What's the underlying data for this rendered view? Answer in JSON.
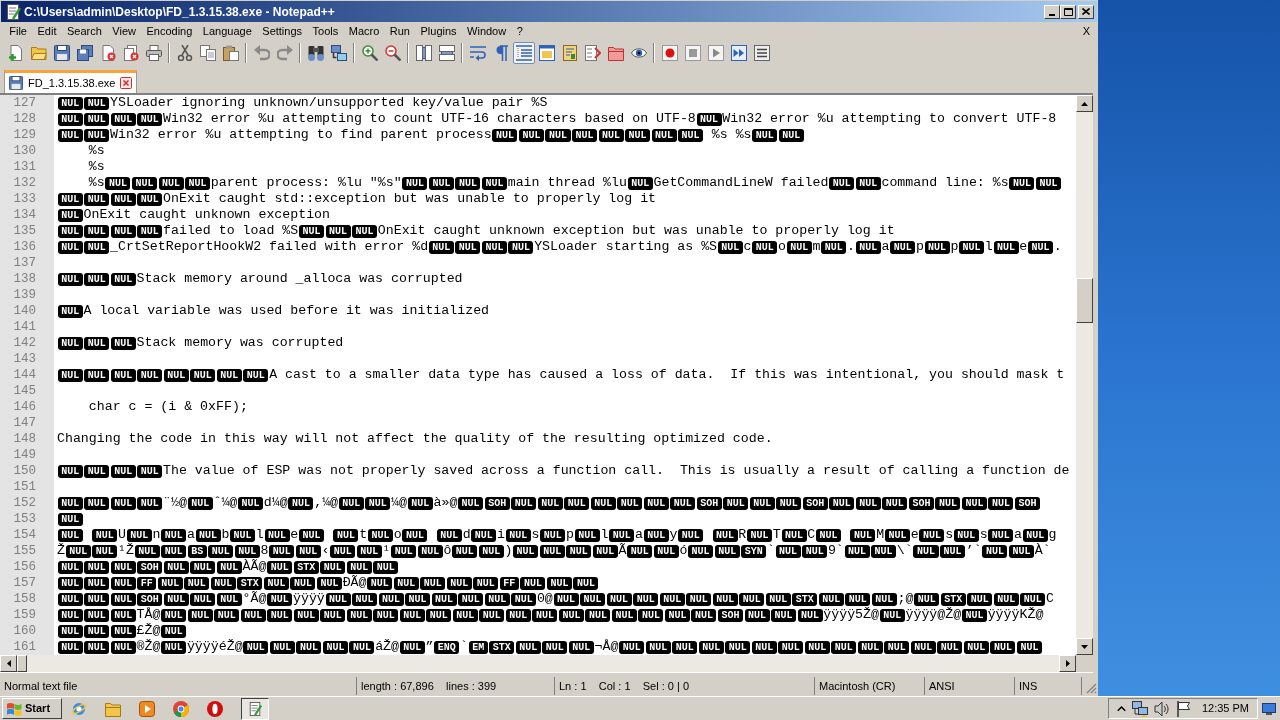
{
  "window": {
    "title": "C:\\Users\\admin\\Desktop\\FD_1.3.15.38.exe - Notepad++"
  },
  "menu": {
    "items": [
      "File",
      "Edit",
      "Search",
      "View",
      "Encoding",
      "Language",
      "Settings",
      "Tools",
      "Macro",
      "Run",
      "Plugins",
      "Window",
      "?"
    ],
    "close_label": "X"
  },
  "toolbar": [
    {
      "buttons": [
        {
          "kind": "new",
          "pressed": false
        },
        {
          "kind": "open",
          "pressed": false
        },
        {
          "kind": "save",
          "pressed": false
        },
        {
          "kind": "saveall",
          "pressed": false
        },
        {
          "kind": "close",
          "pressed": false
        },
        {
          "kind": "closeall",
          "pressed": false
        },
        {
          "kind": "print",
          "pressed": false
        }
      ]
    },
    {
      "buttons": [
        {
          "kind": "cut",
          "pressed": false
        },
        {
          "kind": "copy",
          "pressed": false
        },
        {
          "kind": "paste",
          "pressed": false
        }
      ]
    },
    {
      "buttons": [
        {
          "kind": "undo",
          "pressed": false
        },
        {
          "kind": "redo",
          "pressed": false
        }
      ]
    },
    {
      "buttons": [
        {
          "kind": "find",
          "pressed": false
        },
        {
          "kind": "replace",
          "pressed": false
        }
      ]
    },
    {
      "buttons": [
        {
          "kind": "zoomin",
          "pressed": false
        },
        {
          "kind": "zoomout",
          "pressed": false
        }
      ]
    },
    {
      "buttons": [
        {
          "kind": "syncv",
          "pressed": false
        },
        {
          "kind": "synch",
          "pressed": false
        }
      ]
    },
    {
      "buttons": [
        {
          "kind": "wrap",
          "pressed": false
        },
        {
          "kind": "allchars",
          "pressed": false
        },
        {
          "kind": "indent",
          "pressed": true
        },
        {
          "kind": "udl",
          "pressed": false
        },
        {
          "kind": "docmap",
          "pressed": false
        },
        {
          "kind": "funclist",
          "pressed": false
        },
        {
          "kind": "workspace",
          "pressed": false
        },
        {
          "kind": "monitor",
          "pressed": false
        }
      ]
    },
    {
      "buttons": [
        {
          "kind": "record",
          "pressed": false
        },
        {
          "kind": "stop",
          "pressed": false
        },
        {
          "kind": "play",
          "pressed": false
        },
        {
          "kind": "playmulti",
          "pressed": false
        },
        {
          "kind": "savemacro",
          "pressed": false
        }
      ]
    }
  ],
  "tabs": [
    {
      "label": "FD_1.3.15.38.exe",
      "selected": true,
      "modified": false
    }
  ],
  "editor": {
    "lines": [
      {
        "number": "127",
        "segments": [
          {
            "kind": "ctrl",
            "text": "NUL"
          },
          {
            "kind": "ctrl",
            "text": "NUL"
          },
          {
            "kind": "text",
            "text": "YSLoader ignoring unknown/unsupported key/value pair %S"
          }
        ]
      },
      {
        "number": "128",
        "segments": [
          {
            "kind": "ctrl",
            "text": "NUL"
          },
          {
            "kind": "ctrl",
            "text": "NUL"
          },
          {
            "kind": "ctrl",
            "text": "NUL"
          },
          {
            "kind": "ctrl",
            "text": "NUL"
          },
          {
            "kind": "text",
            "text": "Win32 error %u attempting to count UTF-16 characters based on UTF-8"
          },
          {
            "kind": "ctrl",
            "text": "NUL"
          },
          {
            "kind": "text",
            "text": "Win32 error %u attempting to convert UTF-8"
          }
        ]
      },
      {
        "number": "129",
        "segments": [
          {
            "kind": "ctrl",
            "text": "NUL"
          },
          {
            "kind": "ctrl",
            "text": "NUL"
          },
          {
            "kind": "text",
            "text": "Win32 error %u attempting to find parent process"
          },
          {
            "kind": "ctrl",
            "text": "NUL"
          },
          {
            "kind": "ctrl",
            "text": "NUL"
          },
          {
            "kind": "ctrl",
            "text": "NUL"
          },
          {
            "kind": "ctrl",
            "text": "NUL"
          },
          {
            "kind": "ctrl",
            "text": "NUL"
          },
          {
            "kind": "ctrl",
            "text": "NUL"
          },
          {
            "kind": "ctrl",
            "text": "NUL"
          },
          {
            "kind": "ctrl",
            "text": "NUL"
          },
          {
            "kind": "text",
            "text": " %s %s"
          },
          {
            "kind": "ctrl",
            "text": "NUL"
          },
          {
            "kind": "ctrl",
            "text": "NUL"
          }
        ]
      },
      {
        "number": "130",
        "segments": [
          {
            "kind": "text",
            "text": "    %s"
          }
        ]
      },
      {
        "number": "131",
        "segments": [
          {
            "kind": "text",
            "text": "    %s"
          }
        ]
      },
      {
        "number": "132",
        "segments": [
          {
            "kind": "text",
            "text": "    %s"
          },
          {
            "kind": "ctrl",
            "text": "NUL"
          },
          {
            "kind": "ctrl",
            "text": "NUL"
          },
          {
            "kind": "ctrl",
            "text": "NUL"
          },
          {
            "kind": "ctrl",
            "text": "NUL"
          },
          {
            "kind": "text",
            "text": "parent process: %lu \"%s\""
          },
          {
            "kind": "ctrl",
            "text": "NUL"
          },
          {
            "kind": "ctrl",
            "text": "NUL"
          },
          {
            "kind": "ctrl",
            "text": "NUL"
          },
          {
            "kind": "ctrl",
            "text": "NUL"
          },
          {
            "kind": "text",
            "text": "main thread %lu"
          },
          {
            "kind": "ctrl",
            "text": "NUL"
          },
          {
            "kind": "text",
            "text": "GetCommandLineW failed"
          },
          {
            "kind": "ctrl",
            "text": "NUL"
          },
          {
            "kind": "ctrl",
            "text": "NUL"
          },
          {
            "kind": "text",
            "text": "command line: %s"
          },
          {
            "kind": "ctrl",
            "text": "NUL"
          },
          {
            "kind": "ctrl",
            "text": "NUL"
          }
        ]
      },
      {
        "number": "133",
        "segments": [
          {
            "kind": "ctrl",
            "text": "NUL"
          },
          {
            "kind": "ctrl",
            "text": "NUL"
          },
          {
            "kind": "ctrl",
            "text": "NUL"
          },
          {
            "kind": "ctrl",
            "text": "NUL"
          },
          {
            "kind": "text",
            "text": "OnExit caught std::exception but was unable to properly log it"
          }
        ]
      },
      {
        "number": "134",
        "segments": [
          {
            "kind": "ctrl",
            "text": "NUL"
          },
          {
            "kind": "text",
            "text": "OnExit caught unknown exception"
          }
        ]
      },
      {
        "number": "135",
        "segments": [
          {
            "kind": "ctrl",
            "text": "NUL"
          },
          {
            "kind": "ctrl",
            "text": "NUL"
          },
          {
            "kind": "ctrl",
            "text": "NUL"
          },
          {
            "kind": "ctrl",
            "text": "NUL"
          },
          {
            "kind": "text",
            "text": "failed to load %S"
          },
          {
            "kind": "ctrl",
            "text": "NUL"
          },
          {
            "kind": "ctrl",
            "text": "NUL"
          },
          {
            "kind": "ctrl",
            "text": "NUL"
          },
          {
            "kind": "text",
            "text": "OnExit caught unknown exception but was unable to properly log it"
          }
        ]
      },
      {
        "number": "136",
        "segments": [
          {
            "kind": "ctrl",
            "text": "NUL"
          },
          {
            "kind": "ctrl",
            "text": "NUL"
          },
          {
            "kind": "text",
            "text": "_CrtSetReportHookW2 failed with error %d"
          },
          {
            "kind": "ctrl",
            "text": "NUL"
          },
          {
            "kind": "ctrl",
            "text": "NUL"
          },
          {
            "kind": "ctrl",
            "text": "NUL"
          },
          {
            "kind": "ctrl",
            "text": "NUL"
          },
          {
            "kind": "text",
            "text": "YSLoader starting as %S"
          },
          {
            "kind": "ctrl",
            "text": "NUL"
          },
          {
            "kind": "text",
            "text": "c"
          },
          {
            "kind": "ctrl",
            "text": "NUL"
          },
          {
            "kind": "text",
            "text": "o"
          },
          {
            "kind": "ctrl",
            "text": "NUL"
          },
          {
            "kind": "text",
            "text": "m"
          },
          {
            "kind": "ctrl",
            "text": "NUL"
          },
          {
            "kind": "text",
            "text": "."
          },
          {
            "kind": "ctrl",
            "text": "NUL"
          },
          {
            "kind": "text",
            "text": "a"
          },
          {
            "kind": "ctrl",
            "text": "NUL"
          },
          {
            "kind": "text",
            "text": "p"
          },
          {
            "kind": "ctrl",
            "text": "NUL"
          },
          {
            "kind": "text",
            "text": "p"
          },
          {
            "kind": "ctrl",
            "text": "NUL"
          },
          {
            "kind": "text",
            "text": "l"
          },
          {
            "kind": "ctrl",
            "text": "NUL"
          },
          {
            "kind": "text",
            "text": "e"
          },
          {
            "kind": "ctrl",
            "text": "NUL"
          },
          {
            "kind": "text",
            "text": "."
          }
        ]
      },
      {
        "number": "137"
      },
      {
        "number": "138",
        "segments": [
          {
            "kind": "ctrl",
            "text": "NUL"
          },
          {
            "kind": "ctrl",
            "text": "NUL"
          },
          {
            "kind": "ctrl",
            "text": "NUL"
          },
          {
            "kind": "text",
            "text": "Stack memory around _alloca was corrupted"
          }
        ]
      },
      {
        "number": "139"
      },
      {
        "number": "140",
        "segments": [
          {
            "kind": "ctrl",
            "text": "NUL"
          },
          {
            "kind": "text",
            "text": "A local variable was used before it was initialized"
          }
        ]
      },
      {
        "number": "141"
      },
      {
        "number": "142",
        "segments": [
          {
            "kind": "ctrl",
            "text": "NUL"
          },
          {
            "kind": "ctrl",
            "text": "NUL"
          },
          {
            "kind": "ctrl",
            "text": "NUL"
          },
          {
            "kind": "text",
            "text": "Stack memory was corrupted"
          }
        ]
      },
      {
        "number": "143"
      },
      {
        "number": "144",
        "segments": [
          {
            "kind": "ctrl",
            "text": "NUL"
          },
          {
            "kind": "ctrl",
            "text": "NUL"
          },
          {
            "kind": "ctrl",
            "text": "NUL"
          },
          {
            "kind": "ctrl",
            "text": "NUL"
          },
          {
            "kind": "ctrl",
            "text": "NUL"
          },
          {
            "kind": "ctrl",
            "text": "NUL"
          },
          {
            "kind": "ctrl",
            "text": "NUL"
          },
          {
            "kind": "ctrl",
            "text": "NUL"
          },
          {
            "kind": "text",
            "text": "A cast to a smaller data type has caused a loss of data.  If this was intentional, you should mask t"
          }
        ]
      },
      {
        "number": "145"
      },
      {
        "number": "146",
        "segments": [
          {
            "kind": "text",
            "text": "    char c = (i & 0xFF);"
          }
        ]
      },
      {
        "number": "147"
      },
      {
        "number": "148",
        "segments": [
          {
            "kind": "text",
            "text": "Changing the code in this way will not affect the quality of the resulting optimized code."
          }
        ]
      },
      {
        "number": "149"
      },
      {
        "number": "150",
        "segments": [
          {
            "kind": "ctrl",
            "text": "NUL"
          },
          {
            "kind": "ctrl",
            "text": "NUL"
          },
          {
            "kind": "ctrl",
            "text": "NUL"
          },
          {
            "kind": "ctrl",
            "text": "NUL"
          },
          {
            "kind": "text",
            "text": "The value of ESP was not properly saved across a function call.  This is usually a result of calling a function de"
          }
        ]
      },
      {
        "number": "151"
      },
      {
        "number": "152",
        "segments": [
          {
            "kind": "ctrl",
            "text": "NUL"
          },
          {
            "kind": "ctrl",
            "text": "NUL"
          },
          {
            "kind": "ctrl",
            "text": "NUL"
          },
          {
            "kind": "ctrl",
            "text": "NUL"
          },
          {
            "kind": "text",
            "text": "¨½@"
          },
          {
            "kind": "ctrl",
            "text": "NUL"
          },
          {
            "kind": "text",
            "text": "ˆ¼@"
          },
          {
            "kind": "ctrl",
            "text": "NUL"
          },
          {
            "kind": "text",
            "text": "d¼@"
          },
          {
            "kind": "ctrl",
            "text": "NUL"
          },
          {
            "kind": "text",
            "text": ",¼@"
          },
          {
            "kind": "ctrl",
            "text": "NUL"
          },
          {
            "kind": "ctrl",
            "text": "NUL"
          },
          {
            "kind": "text",
            "text": "¼@"
          },
          {
            "kind": "ctrl",
            "text": "NUL"
          },
          {
            "kind": "text",
            "text": "à»@"
          },
          {
            "kind": "ctrl",
            "text": "NUL"
          },
          {
            "kind": "ctrl",
            "text": "SOH"
          },
          {
            "kind": "ctrl",
            "text": "NUL"
          },
          {
            "kind": "ctrl",
            "text": "NUL"
          },
          {
            "kind": "ctrl",
            "text": "NUL"
          },
          {
            "kind": "ctrl",
            "text": "NUL"
          },
          {
            "kind": "ctrl",
            "text": "NUL"
          },
          {
            "kind": "ctrl",
            "text": "NUL"
          },
          {
            "kind": "ctrl",
            "text": "NUL"
          },
          {
            "kind": "ctrl",
            "text": "SOH"
          },
          {
            "kind": "ctrl",
            "text": "NUL"
          },
          {
            "kind": "ctrl",
            "text": "NUL"
          },
          {
            "kind": "ctrl",
            "text": "NUL"
          },
          {
            "kind": "ctrl",
            "text": "SOH"
          },
          {
            "kind": "ctrl",
            "text": "NUL"
          },
          {
            "kind": "ctrl",
            "text": "NUL"
          },
          {
            "kind": "ctrl",
            "text": "NUL"
          },
          {
            "kind": "ctrl",
            "text": "SOH"
          },
          {
            "kind": "ctrl",
            "text": "NUL"
          },
          {
            "kind": "ctrl",
            "text": "NUL"
          },
          {
            "kind": "ctrl",
            "text": "NUL"
          },
          {
            "kind": "ctrl",
            "text": "SOH"
          }
        ]
      },
      {
        "number": "153",
        "segments": [
          {
            "kind": "ctrl",
            "text": "NUL"
          }
        ]
      },
      {
        "number": "154",
        "segments": [
          {
            "kind": "ctrl",
            "text": "NUL"
          },
          {
            "kind": "space"
          },
          {
            "kind": "ctrl",
            "text": "NUL"
          },
          {
            "kind": "text",
            "text": "U"
          },
          {
            "kind": "ctrl",
            "text": "NUL"
          },
          {
            "kind": "text",
            "text": "n"
          },
          {
            "kind": "ctrl",
            "text": "NUL"
          },
          {
            "kind": "text",
            "text": "a"
          },
          {
            "kind": "ctrl",
            "text": "NUL"
          },
          {
            "kind": "text",
            "text": "b"
          },
          {
            "kind": "ctrl",
            "text": "NUL"
          },
          {
            "kind": "text",
            "text": "l"
          },
          {
            "kind": "ctrl",
            "text": "NUL"
          },
          {
            "kind": "text",
            "text": "e"
          },
          {
            "kind": "ctrl",
            "text": "NUL"
          },
          {
            "kind": "space"
          },
          {
            "kind": "ctrl",
            "text": "NUL"
          },
          {
            "kind": "text",
            "text": "t"
          },
          {
            "kind": "ctrl",
            "text": "NUL"
          },
          {
            "kind": "text",
            "text": "o"
          },
          {
            "kind": "ctrl",
            "text": "NUL"
          },
          {
            "kind": "space"
          },
          {
            "kind": "ctrl",
            "text": "NUL"
          },
          {
            "kind": "text",
            "text": "d"
          },
          {
            "kind": "ctrl",
            "text": "NUL"
          },
          {
            "kind": "text",
            "text": "i"
          },
          {
            "kind": "ctrl",
            "text": "NUL"
          },
          {
            "kind": "text",
            "text": "s"
          },
          {
            "kind": "ctrl",
            "text": "NUL"
          },
          {
            "kind": "text",
            "text": "p"
          },
          {
            "kind": "ctrl",
            "text": "NUL"
          },
          {
            "kind": "text",
            "text": "l"
          },
          {
            "kind": "ctrl",
            "text": "NUL"
          },
          {
            "kind": "text",
            "text": "a"
          },
          {
            "kind": "ctrl",
            "text": "NUL"
          },
          {
            "kind": "text",
            "text": "y"
          },
          {
            "kind": "ctrl",
            "text": "NUL"
          },
          {
            "kind": "space"
          },
          {
            "kind": "ctrl",
            "text": "NUL"
          },
          {
            "kind": "text",
            "text": "R"
          },
          {
            "kind": "ctrl",
            "text": "NUL"
          },
          {
            "kind": "text",
            "text": "T"
          },
          {
            "kind": "ctrl",
            "text": "NUL"
          },
          {
            "kind": "text",
            "text": "C"
          },
          {
            "kind": "ctrl",
            "text": "NUL"
          },
          {
            "kind": "space"
          },
          {
            "kind": "ctrl",
            "text": "NUL"
          },
          {
            "kind": "text",
            "text": "M"
          },
          {
            "kind": "ctrl",
            "text": "NUL"
          },
          {
            "kind": "text",
            "text": "e"
          },
          {
            "kind": "ctrl",
            "text": "NUL"
          },
          {
            "kind": "text",
            "text": "s"
          },
          {
            "kind": "ctrl",
            "text": "NUL"
          },
          {
            "kind": "text",
            "text": "s"
          },
          {
            "kind": "ctrl",
            "text": "NUL"
          },
          {
            "kind": "text",
            "text": "a"
          },
          {
            "kind": "ctrl",
            "text": "NUL"
          },
          {
            "kind": "text",
            "text": "g"
          }
        ]
      },
      {
        "number": "155",
        "segments": [
          {
            "kind": "text",
            "text": "Ž"
          },
          {
            "kind": "ctrl",
            "text": "NUL"
          },
          {
            "kind": "ctrl",
            "text": "NUL"
          },
          {
            "kind": "text",
            "text": "¹Ž"
          },
          {
            "kind": "ctrl",
            "text": "NUL"
          },
          {
            "kind": "ctrl",
            "text": "NUL"
          },
          {
            "kind": "ctrl",
            "text": "BS"
          },
          {
            "kind": "ctrl",
            "text": "NUL"
          },
          {
            "kind": "ctrl",
            "text": "NUL"
          },
          {
            "kind": "text",
            "text": "8"
          },
          {
            "kind": "ctrl",
            "text": "NUL"
          },
          {
            "kind": "ctrl",
            "text": "NUL"
          },
          {
            "kind": "text",
            "text": "‹"
          },
          {
            "kind": "ctrl",
            "text": "NUL"
          },
          {
            "kind": "ctrl",
            "text": "NUL"
          },
          {
            "kind": "text",
            "text": "¹"
          },
          {
            "kind": "ctrl",
            "text": "NUL"
          },
          {
            "kind": "ctrl",
            "text": "NUL"
          },
          {
            "kind": "text",
            "text": "ô"
          },
          {
            "kind": "ctrl",
            "text": "NUL"
          },
          {
            "kind": "ctrl",
            "text": "NUL"
          },
          {
            "kind": "text",
            "text": ")"
          },
          {
            "kind": "ctrl",
            "text": "NUL"
          },
          {
            "kind": "ctrl",
            "text": "NUL"
          },
          {
            "kind": "ctrl",
            "text": "NUL"
          },
          {
            "kind": "ctrl",
            "text": "NUL"
          },
          {
            "kind": "text",
            "text": "Ã"
          },
          {
            "kind": "ctrl",
            "text": "NUL"
          },
          {
            "kind": "ctrl",
            "text": "NUL"
          },
          {
            "kind": "text",
            "text": "ó"
          },
          {
            "kind": "ctrl",
            "text": "NUL"
          },
          {
            "kind": "ctrl",
            "text": "NUL"
          },
          {
            "kind": "ctrl",
            "text": "SYN"
          },
          {
            "kind": "text",
            "text": "`"
          },
          {
            "kind": "ctrl",
            "text": "NUL"
          },
          {
            "kind": "ctrl",
            "text": "NUL"
          },
          {
            "kind": "text",
            "text": "9`"
          },
          {
            "kind": "ctrl",
            "text": "NUL"
          },
          {
            "kind": "ctrl",
            "text": "NUL"
          },
          {
            "kind": "text",
            "text": "\\`"
          },
          {
            "kind": "ctrl",
            "text": "NUL"
          },
          {
            "kind": "ctrl",
            "text": "NUL"
          },
          {
            "kind": "text",
            "text": "’`"
          },
          {
            "kind": "ctrl",
            "text": "NUL"
          },
          {
            "kind": "ctrl",
            "text": "NUL"
          },
          {
            "kind": "text",
            "text": "À`"
          }
        ]
      },
      {
        "number": "156",
        "segments": [
          {
            "kind": "ctrl",
            "text": "NUL"
          },
          {
            "kind": "ctrl",
            "text": "NUL"
          },
          {
            "kind": "ctrl",
            "text": "NUL"
          },
          {
            "kind": "ctrl",
            "text": "SOH"
          },
          {
            "kind": "ctrl",
            "text": "NUL"
          },
          {
            "kind": "ctrl",
            "text": "NUL"
          },
          {
            "kind": "ctrl",
            "text": "NUL"
          },
          {
            "kind": "text",
            "text": "ÀÃ@"
          },
          {
            "kind": "ctrl",
            "text": "NUL"
          },
          {
            "kind": "ctrl",
            "text": "STX"
          },
          {
            "kind": "ctrl",
            "text": "NUL"
          },
          {
            "kind": "ctrl",
            "text": "NUL"
          },
          {
            "kind": "ctrl",
            "text": "NUL"
          }
        ]
      },
      {
        "number": "157",
        "segments": [
          {
            "kind": "ctrl",
            "text": "NUL"
          },
          {
            "kind": "ctrl",
            "text": "NUL"
          },
          {
            "kind": "ctrl",
            "text": "NUL"
          },
          {
            "kind": "ctrl",
            "text": "FF"
          },
          {
            "kind": "ctrl",
            "text": "NUL"
          },
          {
            "kind": "ctrl",
            "text": "NUL"
          },
          {
            "kind": "ctrl",
            "text": "NUL"
          },
          {
            "kind": "ctrl",
            "text": "STX"
          },
          {
            "kind": "ctrl",
            "text": "NUL"
          },
          {
            "kind": "ctrl",
            "text": "NUL"
          },
          {
            "kind": "ctrl",
            "text": "NUL"
          },
          {
            "kind": "text",
            "text": "ÐÃ@"
          },
          {
            "kind": "ctrl",
            "text": "NUL"
          },
          {
            "kind": "ctrl",
            "text": "NUL"
          },
          {
            "kind": "ctrl",
            "text": "NUL"
          },
          {
            "kind": "ctrl",
            "text": "NUL"
          },
          {
            "kind": "ctrl",
            "text": "NUL"
          },
          {
            "kind": "ctrl",
            "text": "FF"
          },
          {
            "kind": "ctrl",
            "text": "NUL"
          },
          {
            "kind": "ctrl",
            "text": "NUL"
          },
          {
            "kind": "ctrl",
            "text": "NUL"
          }
        ]
      },
      {
        "number": "158",
        "segments": [
          {
            "kind": "ctrl",
            "text": "NUL"
          },
          {
            "kind": "ctrl",
            "text": "NUL"
          },
          {
            "kind": "ctrl",
            "text": "NUL"
          },
          {
            "kind": "ctrl",
            "text": "SOH"
          },
          {
            "kind": "ctrl",
            "text": "NUL"
          },
          {
            "kind": "ctrl",
            "text": "NUL"
          },
          {
            "kind": "ctrl",
            "text": "NUL"
          },
          {
            "kind": "text",
            "text": "°Ã@"
          },
          {
            "kind": "ctrl",
            "text": "NUL"
          },
          {
            "kind": "text",
            "text": "ÿÿÿÿ"
          },
          {
            "kind": "ctrl",
            "text": "NUL"
          },
          {
            "kind": "ctrl",
            "text": "NUL"
          },
          {
            "kind": "ctrl",
            "text": "NUL"
          },
          {
            "kind": "ctrl",
            "text": "NUL"
          },
          {
            "kind": "ctrl",
            "text": "NUL"
          },
          {
            "kind": "ctrl",
            "text": "NUL"
          },
          {
            "kind": "ctrl",
            "text": "NUL"
          },
          {
            "kind": "ctrl",
            "text": "NUL"
          },
          {
            "kind": "text",
            "text": "0@"
          },
          {
            "kind": "ctrl",
            "text": "NUL"
          },
          {
            "kind": "ctrl",
            "text": "NUL"
          },
          {
            "kind": "ctrl",
            "text": "NUL"
          },
          {
            "kind": "ctrl",
            "text": "NUL"
          },
          {
            "kind": "ctrl",
            "text": "NUL"
          },
          {
            "kind": "ctrl",
            "text": "NUL"
          },
          {
            "kind": "ctrl",
            "text": "NUL"
          },
          {
            "kind": "ctrl",
            "text": "NUL"
          },
          {
            "kind": "ctrl",
            "text": "NUL"
          },
          {
            "kind": "ctrl",
            "text": "STX"
          },
          {
            "kind": "ctrl",
            "text": "NUL"
          },
          {
            "kind": "ctrl",
            "text": "NUL"
          },
          {
            "kind": "ctrl",
            "text": "NUL"
          },
          {
            "kind": "text",
            "text": ";@"
          },
          {
            "kind": "ctrl",
            "text": "NUL"
          },
          {
            "kind": "ctrl",
            "text": "STX"
          },
          {
            "kind": "ctrl",
            "text": "NUL"
          },
          {
            "kind": "ctrl",
            "text": "NUL"
          },
          {
            "kind": "ctrl",
            "text": "NUL"
          },
          {
            "kind": "text",
            "text": "C"
          }
        ]
      },
      {
        "number": "159",
        "segments": [
          {
            "kind": "ctrl",
            "text": "NUL"
          },
          {
            "kind": "ctrl",
            "text": "NUL"
          },
          {
            "kind": "ctrl",
            "text": "NUL"
          },
          {
            "kind": "text",
            "text": "TÅ@"
          },
          {
            "kind": "ctrl",
            "text": "NUL"
          },
          {
            "kind": "ctrl",
            "text": "NUL"
          },
          {
            "kind": "ctrl",
            "text": "NUL"
          },
          {
            "kind": "ctrl",
            "text": "NUL"
          },
          {
            "kind": "ctrl",
            "text": "NUL"
          },
          {
            "kind": "ctrl",
            "text": "NUL"
          },
          {
            "kind": "ctrl",
            "text": "NUL"
          },
          {
            "kind": "ctrl",
            "text": "NUL"
          },
          {
            "kind": "ctrl",
            "text": "NUL"
          },
          {
            "kind": "ctrl",
            "text": "NUL"
          },
          {
            "kind": "ctrl",
            "text": "NUL"
          },
          {
            "kind": "ctrl",
            "text": "NUL"
          },
          {
            "kind": "ctrl",
            "text": "NUL"
          },
          {
            "kind": "ctrl",
            "text": "NUL"
          },
          {
            "kind": "ctrl",
            "text": "NUL"
          },
          {
            "kind": "ctrl",
            "text": "NUL"
          },
          {
            "kind": "ctrl",
            "text": "NUL"
          },
          {
            "kind": "ctrl",
            "text": "NUL"
          },
          {
            "kind": "ctrl",
            "text": "NUL"
          },
          {
            "kind": "ctrl",
            "text": "NUL"
          },
          {
            "kind": "ctrl",
            "text": "NUL"
          },
          {
            "kind": "ctrl",
            "text": "SOH"
          },
          {
            "kind": "ctrl",
            "text": "NUL"
          },
          {
            "kind": "ctrl",
            "text": "NUL"
          },
          {
            "kind": "ctrl",
            "text": "NUL"
          },
          {
            "kind": "text",
            "text": "ÿÿÿÿ5Ž@"
          },
          {
            "kind": "ctrl",
            "text": "NUL"
          },
          {
            "kind": "text",
            "text": "ÿÿÿÿ@Ž@"
          },
          {
            "kind": "ctrl",
            "text": "NUL"
          },
          {
            "kind": "text",
            "text": "ÿÿÿÿKŽ@"
          }
        ]
      },
      {
        "number": "160",
        "segments": [
          {
            "kind": "ctrl",
            "text": "NUL"
          },
          {
            "kind": "ctrl",
            "text": "NUL"
          },
          {
            "kind": "ctrl",
            "text": "NUL"
          },
          {
            "kind": "text",
            "text": "£Ž@"
          },
          {
            "kind": "ctrl",
            "text": "NUL"
          }
        ]
      },
      {
        "number": "161",
        "segments": [
          {
            "kind": "ctrl",
            "text": "NUL"
          },
          {
            "kind": "ctrl",
            "text": "NUL"
          },
          {
            "kind": "ctrl",
            "text": "NUL"
          },
          {
            "kind": "text",
            "text": "®Ž@"
          },
          {
            "kind": "ctrl",
            "text": "NUL"
          },
          {
            "kind": "text",
            "text": "ÿÿÿÿéŽ@"
          },
          {
            "kind": "ctrl",
            "text": "NUL"
          },
          {
            "kind": "ctrl",
            "text": "NUL"
          },
          {
            "kind": "ctrl",
            "text": "NUL"
          },
          {
            "kind": "ctrl",
            "text": "NUL"
          },
          {
            "kind": "ctrl",
            "text": "NUL"
          },
          {
            "kind": "text",
            "text": "áŽ@"
          },
          {
            "kind": "ctrl",
            "text": "NUL"
          },
          {
            "kind": "text",
            "text": "”"
          },
          {
            "kind": "ctrl",
            "text": "ENQ"
          },
          {
            "kind": "text",
            "text": "`"
          },
          {
            "kind": "ctrl",
            "text": "EM"
          },
          {
            "kind": "ctrl",
            "text": "STX"
          },
          {
            "kind": "ctrl",
            "text": "NUL"
          },
          {
            "kind": "ctrl",
            "text": "NUL"
          },
          {
            "kind": "ctrl",
            "text": "NUL"
          },
          {
            "kind": "text",
            "text": "¬Å@"
          },
          {
            "kind": "ctrl",
            "text": "NUL"
          },
          {
            "kind": "ctrl",
            "text": "NUL"
          },
          {
            "kind": "ctrl",
            "text": "NUL"
          },
          {
            "kind": "ctrl",
            "text": "NUL"
          },
          {
            "kind": "ctrl",
            "text": "NUL"
          },
          {
            "kind": "ctrl",
            "text": "NUL"
          },
          {
            "kind": "ctrl",
            "text": "NUL"
          },
          {
            "kind": "ctrl",
            "text": "NUL"
          },
          {
            "kind": "ctrl",
            "text": "NUL"
          },
          {
            "kind": "ctrl",
            "text": "NUL"
          },
          {
            "kind": "ctrl",
            "text": "NUL"
          },
          {
            "kind": "ctrl",
            "text": "NUL"
          },
          {
            "kind": "ctrl",
            "text": "NUL"
          },
          {
            "kind": "ctrl",
            "text": "NUL"
          },
          {
            "kind": "ctrl",
            "text": "NUL"
          },
          {
            "kind": "ctrl",
            "text": "NUL"
          }
        ]
      }
    ]
  },
  "status_bar": [
    "Normal text file",
    "length : 67,896    lines : 399",
    "Ln : 1    Col : 1    Sel : 0 | 0",
    "Macintosh (CR)",
    "ANSI",
    "INS"
  ],
  "taskbar": {
    "start": "Start",
    "apps": [
      {
        "kind": "globe",
        "active": false
      },
      {
        "kind": "folder",
        "active": false
      },
      {
        "kind": "media",
        "active": false
      },
      {
        "kind": "chrome",
        "active": false
      },
      {
        "kind": "opera",
        "active": false
      },
      {
        "kind": "notepad",
        "active": true
      }
    ],
    "tray": [
      {
        "kind": "chevron"
      },
      {
        "kind": "network"
      },
      {
        "kind": "speaker"
      },
      {
        "kind": "flag"
      }
    ],
    "clock": "12:35 PM"
  }
}
